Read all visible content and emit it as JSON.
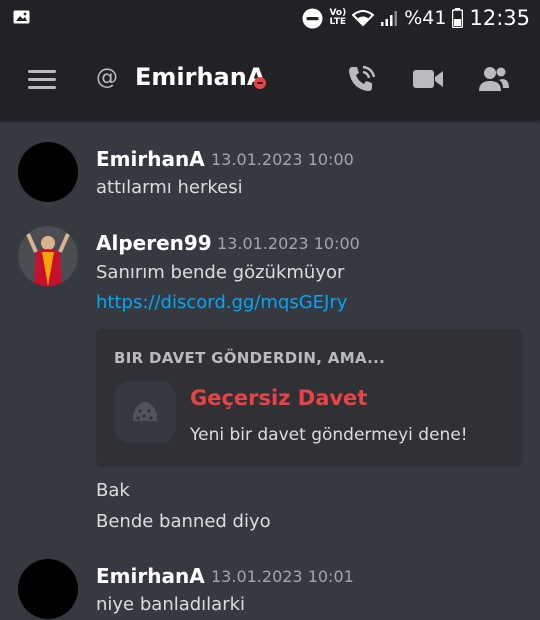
{
  "status_bar": {
    "volte_top": "Vo)",
    "volte_bottom": "LTE",
    "battery": "%41",
    "time": "12:35"
  },
  "header": {
    "channel_name": "EmirhanA",
    "icons": [
      "menu-icon",
      "at-icon",
      "call-icon",
      "video-icon",
      "members-icon"
    ],
    "status_color": "#ed4245"
  },
  "messages": [
    {
      "author": "EmirhanA",
      "timestamp": "13.01.2023 10:00",
      "lines": [
        "attılarmı herkesi"
      ]
    },
    {
      "author": "Alperen99",
      "timestamp": "13.01.2023 10:00",
      "lines": [
        "Sanırım bende gözükmüyor"
      ],
      "link": "https://discord.gg/mqsGEJry",
      "invite": {
        "header": "BIR DAVET GÖNDERDIN, AMA...",
        "title": "Geçersiz Davet",
        "subtitle": "Yeni bir davet göndermeyi dene!"
      },
      "followups": [
        "Bak",
        "Bende banned diyo"
      ]
    },
    {
      "author": "EmirhanA",
      "timestamp": "13.01.2023 10:01",
      "lines": [
        "niye banladılarki"
      ]
    }
  ],
  "colors": {
    "background": "#36393f",
    "bar": "#202225",
    "link": "#00a8fc",
    "error": "#ed4245"
  }
}
